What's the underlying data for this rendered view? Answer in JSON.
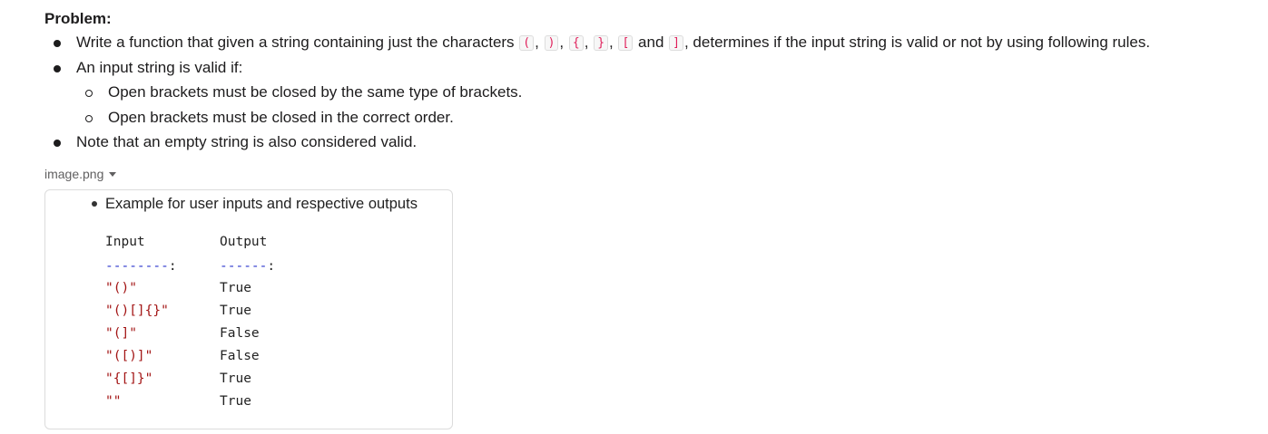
{
  "heading": "Problem:",
  "bullets": {
    "b1": {
      "before": "Write a function that given a string containing just the characters",
      "chars": [
        "(",
        ")",
        "{",
        "}",
        "[",
        "]"
      ],
      "sep": ",",
      "and": "and",
      "after": ", determines if the input string is valid or not by using following rules."
    },
    "b2": "An input string is valid if:",
    "sub1": "Open brackets must be closed by the same type of brackets.",
    "sub2": "Open brackets must be closed in the correct order.",
    "b3": "Note that an empty string is also considered valid."
  },
  "attachment": {
    "name": "image.png"
  },
  "image": {
    "bullet": "Example for user inputs and respective outputs",
    "table": {
      "header_input": "Input",
      "header_output": "Output",
      "sep_input_dashes": "--------",
      "sep_output_dashes": "------",
      "sep_colon": ":",
      "rows": [
        {
          "input": "\"()\"",
          "output": "True"
        },
        {
          "input": "\"()[]{}\"",
          "output": "True"
        },
        {
          "input": "\"(]\"",
          "output": "False"
        },
        {
          "input": "\"([)]\"",
          "output": "False"
        },
        {
          "input": "\"{[]}\"",
          "output": "True"
        },
        {
          "input": "\"\"",
          "output": "True"
        }
      ]
    }
  }
}
